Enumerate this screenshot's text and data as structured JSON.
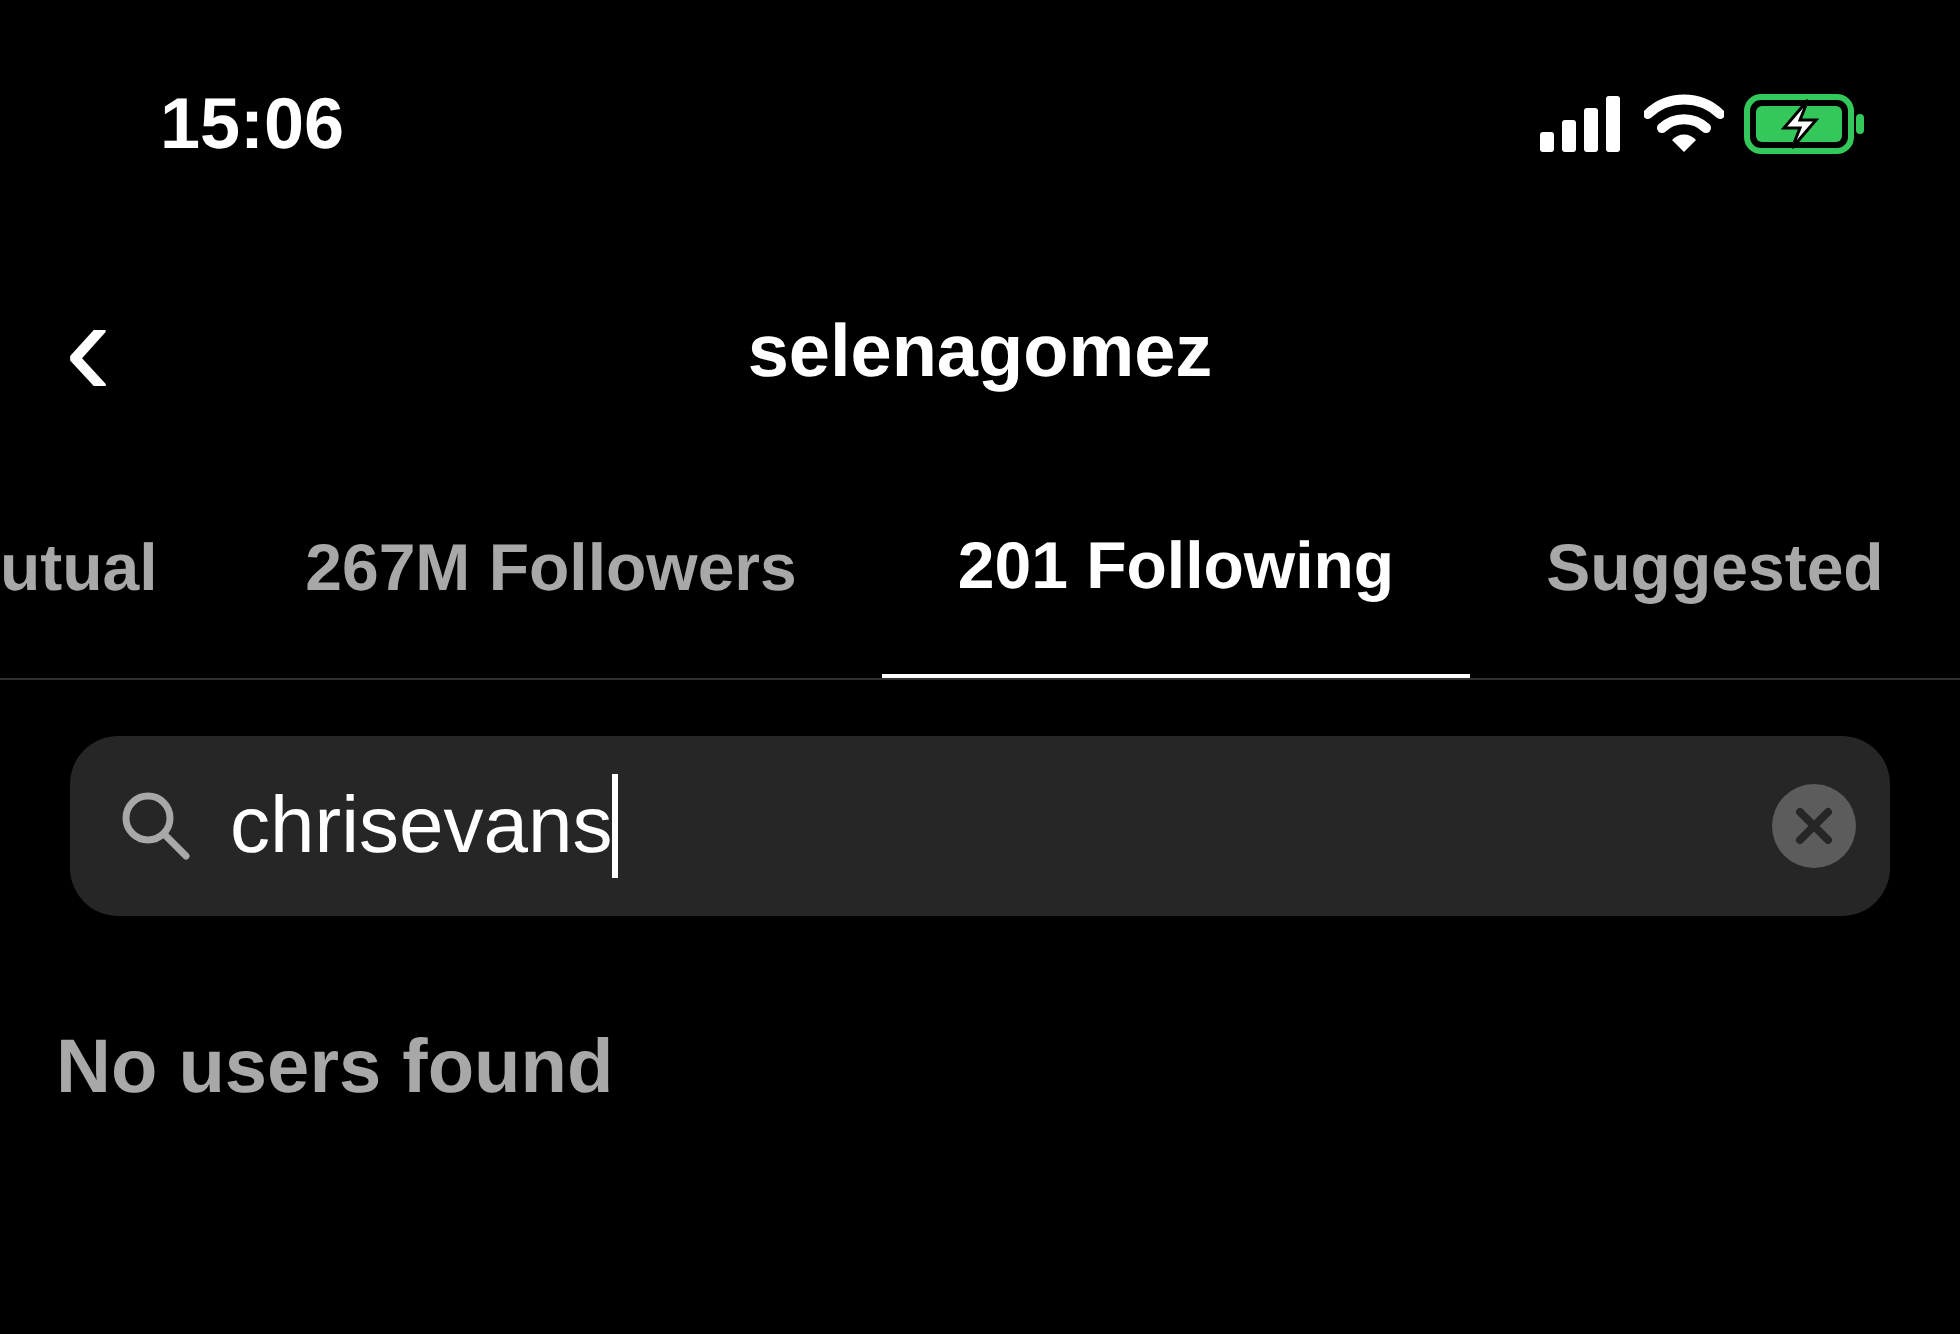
{
  "status_bar": {
    "time": "15:06",
    "battery_charging": true
  },
  "header": {
    "back": "‹",
    "title": "selenagomez"
  },
  "tabs": [
    {
      "label": "utual",
      "selected": false
    },
    {
      "label": "267M Followers",
      "selected": false
    },
    {
      "label": "201 Following",
      "selected": true
    },
    {
      "label": "Suggested",
      "selected": false
    }
  ],
  "search": {
    "value": "chrisevans",
    "focused": true
  },
  "message": "No users found"
}
